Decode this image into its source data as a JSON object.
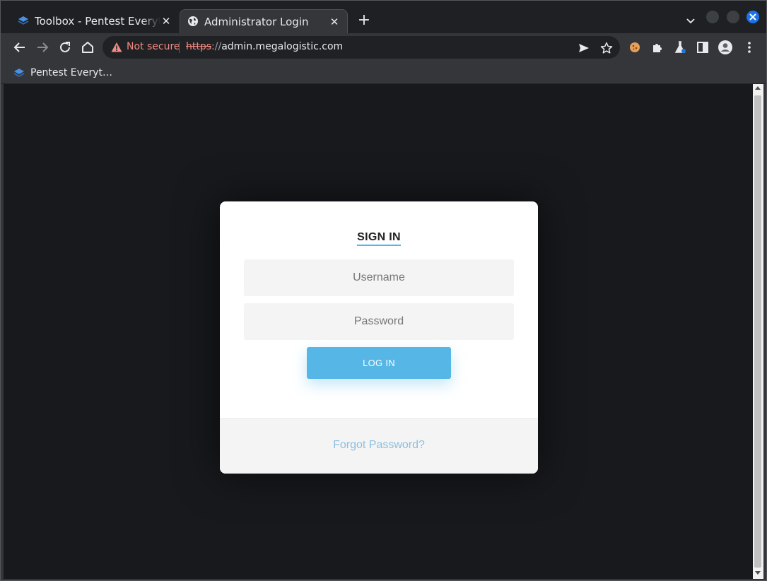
{
  "browser": {
    "tabs": [
      {
        "title": "Toolbox - Pentest Everything",
        "active": false,
        "favicon": "layers-icon"
      },
      {
        "title": "Administrator Login",
        "active": true,
        "favicon": "globe-icon"
      }
    ],
    "security_label": "Not secure",
    "url": {
      "scheme": "https",
      "separator": "://",
      "host": "admin.megalogistic.com"
    },
    "bookmarks": [
      {
        "label": "Pentest Everyt…",
        "icon": "layers-icon"
      }
    ],
    "colors": {
      "accent": "#1a73e8",
      "warning": "#f28b82"
    }
  },
  "login": {
    "heading": "SIGN IN",
    "username_placeholder": "Username",
    "password_placeholder": "Password",
    "login_button": "LOG IN",
    "forgot_link": "Forgot Password?",
    "colors": {
      "primary": "#56b6e6",
      "link": "#8bbfe0",
      "card_bg": "#ffffff",
      "page_bg": "#17191c"
    }
  }
}
